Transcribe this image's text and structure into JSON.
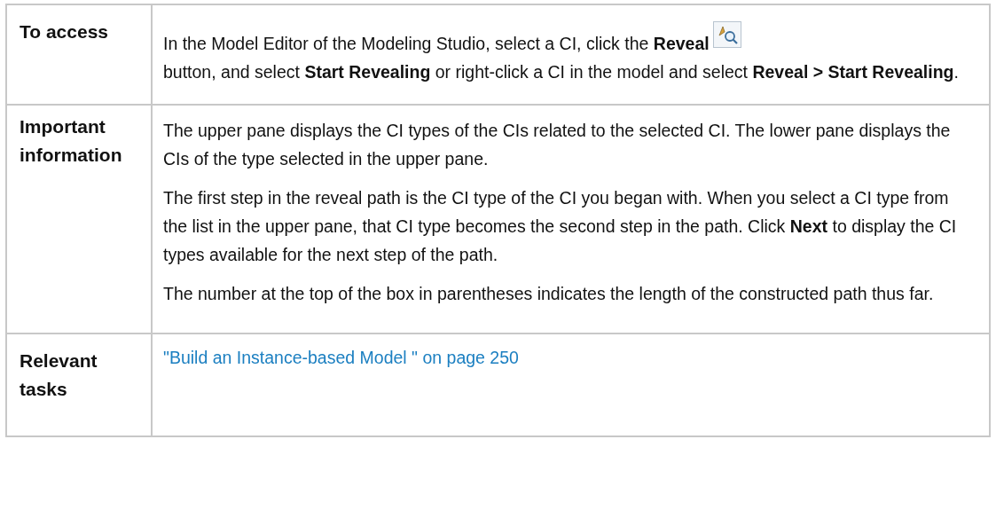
{
  "table": {
    "rows": [
      {
        "label": "To access",
        "kind": "text",
        "paragraphs": [
          {
            "parts": [
              "In the Model Editor of the Modeling Studio, select a CI, click the **Reveal**",
              "button, and select **Start Revealing** or right-click a CI in the model and select **Reveal > Start Revealing**."
            ]
          }
        ]
      },
      {
        "label": "Important information",
        "kind": "text",
        "paragraphs": [
          {
            "parts": [
              "The upper pane displays the CI types of the CIs related to the selected CI. The lower pane displays the CIs of the type selected in the upper pane."
            ]
          },
          {
            "parts": [
              "The first step in the reveal path is the CI type of the CI you began with. When you select a CI type from the list in the upper pane, that CI type becomes the second step in the path. Click **Next** to display the CI types available for the next step of the path."
            ]
          },
          {
            "parts": [
              "The number at the top of the box in parentheses indicates the length of the constructed path thus far."
            ]
          }
        ]
      },
      {
        "label": "Relevant tasks",
        "kind": "link",
        "link": "\"Build an Instance-based Model \" on page 250"
      }
    ]
  }
}
